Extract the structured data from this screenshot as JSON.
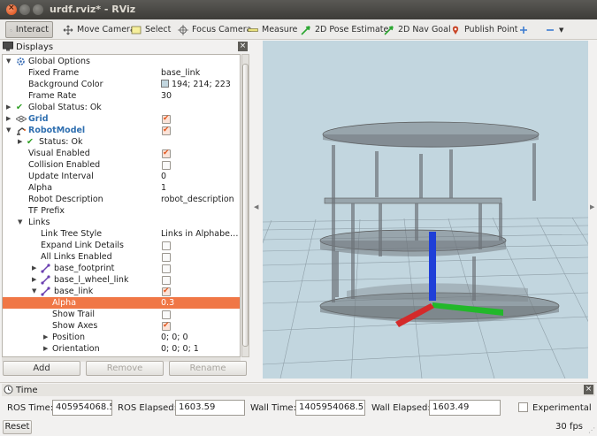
{
  "window": {
    "title": "urdf.rviz* - RViz"
  },
  "toolbar": {
    "interact": "Interact",
    "move_camera": "Move Camera",
    "select": "Select",
    "focus_camera": "Focus Camera",
    "measure": "Measure",
    "pose_estimate": "2D Pose Estimate",
    "nav_goal": "2D Nav Goal",
    "publish_point": "Publish Point"
  },
  "displays": {
    "title": "Displays",
    "rows": {
      "global_options": "Global Options",
      "fixed_frame": "Fixed Frame",
      "fixed_frame_val": "base_link",
      "bg_color": "Background Color",
      "bg_color_val": "194; 214; 223",
      "frame_rate": "Frame Rate",
      "frame_rate_val": "30",
      "global_status": "Global Status: Ok",
      "grid": "Grid",
      "robot_model": "RobotModel",
      "status": "Status: Ok",
      "visual_enabled": "Visual Enabled",
      "collision_enabled": "Collision Enabled",
      "update_interval": "Update Interval",
      "update_interval_val": "0",
      "alpha": "Alpha",
      "alpha_val": "1",
      "robot_description": "Robot Description",
      "robot_description_val": "robot_description",
      "tf_prefix": "TF Prefix",
      "links": "Links",
      "link_tree_style": "Link Tree Style",
      "link_tree_style_val": "Links in Alphabe…",
      "expand_link_details": "Expand Link Details",
      "all_links_enabled": "All Links Enabled",
      "base_footprint": "base_footprint",
      "base_l_wheel_link": "base_l_wheel_link",
      "base_link": "base_link",
      "link_alpha": "Alpha",
      "link_alpha_val": "0.3",
      "show_trail": "Show Trail",
      "show_axes": "Show Axes",
      "position": "Position",
      "position_val": "0; 0; 0",
      "orientation": "Orientation",
      "orientation_val": "0; 0; 0; 1"
    },
    "buttons": {
      "add": "Add",
      "remove": "Remove",
      "rename": "Rename"
    }
  },
  "time": {
    "title": "Time",
    "ros_time_label": "ROS Time:",
    "ros_time": "405954068.54",
    "ros_elapsed_label": "ROS Elapsed:",
    "ros_elapsed": "1603.59",
    "wall_time_label": "Wall Time:",
    "wall_time": "1405954068.57",
    "wall_elapsed_label": "Wall Elapsed:",
    "wall_elapsed": "1603.49",
    "experimental": "Experimental",
    "reset": "Reset",
    "fps": "30 fps"
  },
  "colors": {
    "background": "#c2d6df",
    "selection": "#f07746",
    "axis_x": "#d42a2a",
    "axis_y": "#22b82a",
    "axis_z": "#1f3fd8"
  }
}
